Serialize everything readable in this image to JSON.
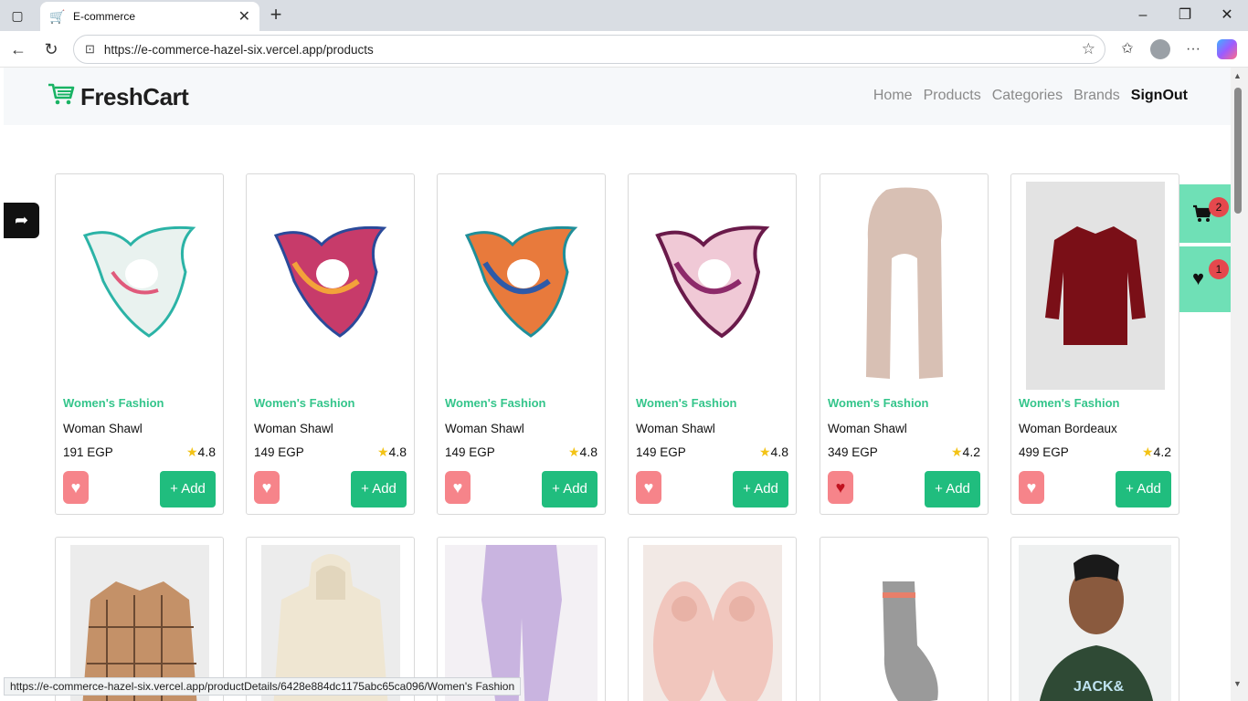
{
  "browser": {
    "tab_title": "E-commerce",
    "url": "https://e-commerce-hazel-six.vercel.app/products",
    "status_url": "https://e-commerce-hazel-six.vercel.app/productDetails/6428e884dc1175abc65ca096/Women's Fashion"
  },
  "navbar": {
    "logo": "FreshCart",
    "links": [
      "Home",
      "Products",
      "Categories",
      "Brands"
    ],
    "signout": "SignOut"
  },
  "floating": {
    "cart_count": "2",
    "wishlist_count": "1"
  },
  "actions": {
    "add_label": "+ Add"
  },
  "products": [
    {
      "category": "Women's Fashion",
      "title": "Woman Shawl",
      "price": "191 EGP",
      "rating": "4.8",
      "wishlisted": false
    },
    {
      "category": "Women's Fashion",
      "title": "Woman Shawl",
      "price": "149 EGP",
      "rating": "4.8",
      "wishlisted": false
    },
    {
      "category": "Women's Fashion",
      "title": "Woman Shawl",
      "price": "149 EGP",
      "rating": "4.8",
      "wishlisted": false
    },
    {
      "category": "Women's Fashion",
      "title": "Woman Shawl",
      "price": "149 EGP",
      "rating": "4.8",
      "wishlisted": false
    },
    {
      "category": "Women's Fashion",
      "title": "Woman Shawl",
      "price": "349 EGP",
      "rating": "4.2",
      "wishlisted": true
    },
    {
      "category": "Women's Fashion",
      "title": "Woman Bordeaux",
      "price": "499 EGP",
      "rating": "4.2",
      "wishlisted": false
    }
  ],
  "colors": {
    "accent": "#20bd7e",
    "category_text": "#34c58b",
    "heart_bg": "#f6848a",
    "float_bg": "#6fe0b6",
    "badge": "#e5484d"
  }
}
